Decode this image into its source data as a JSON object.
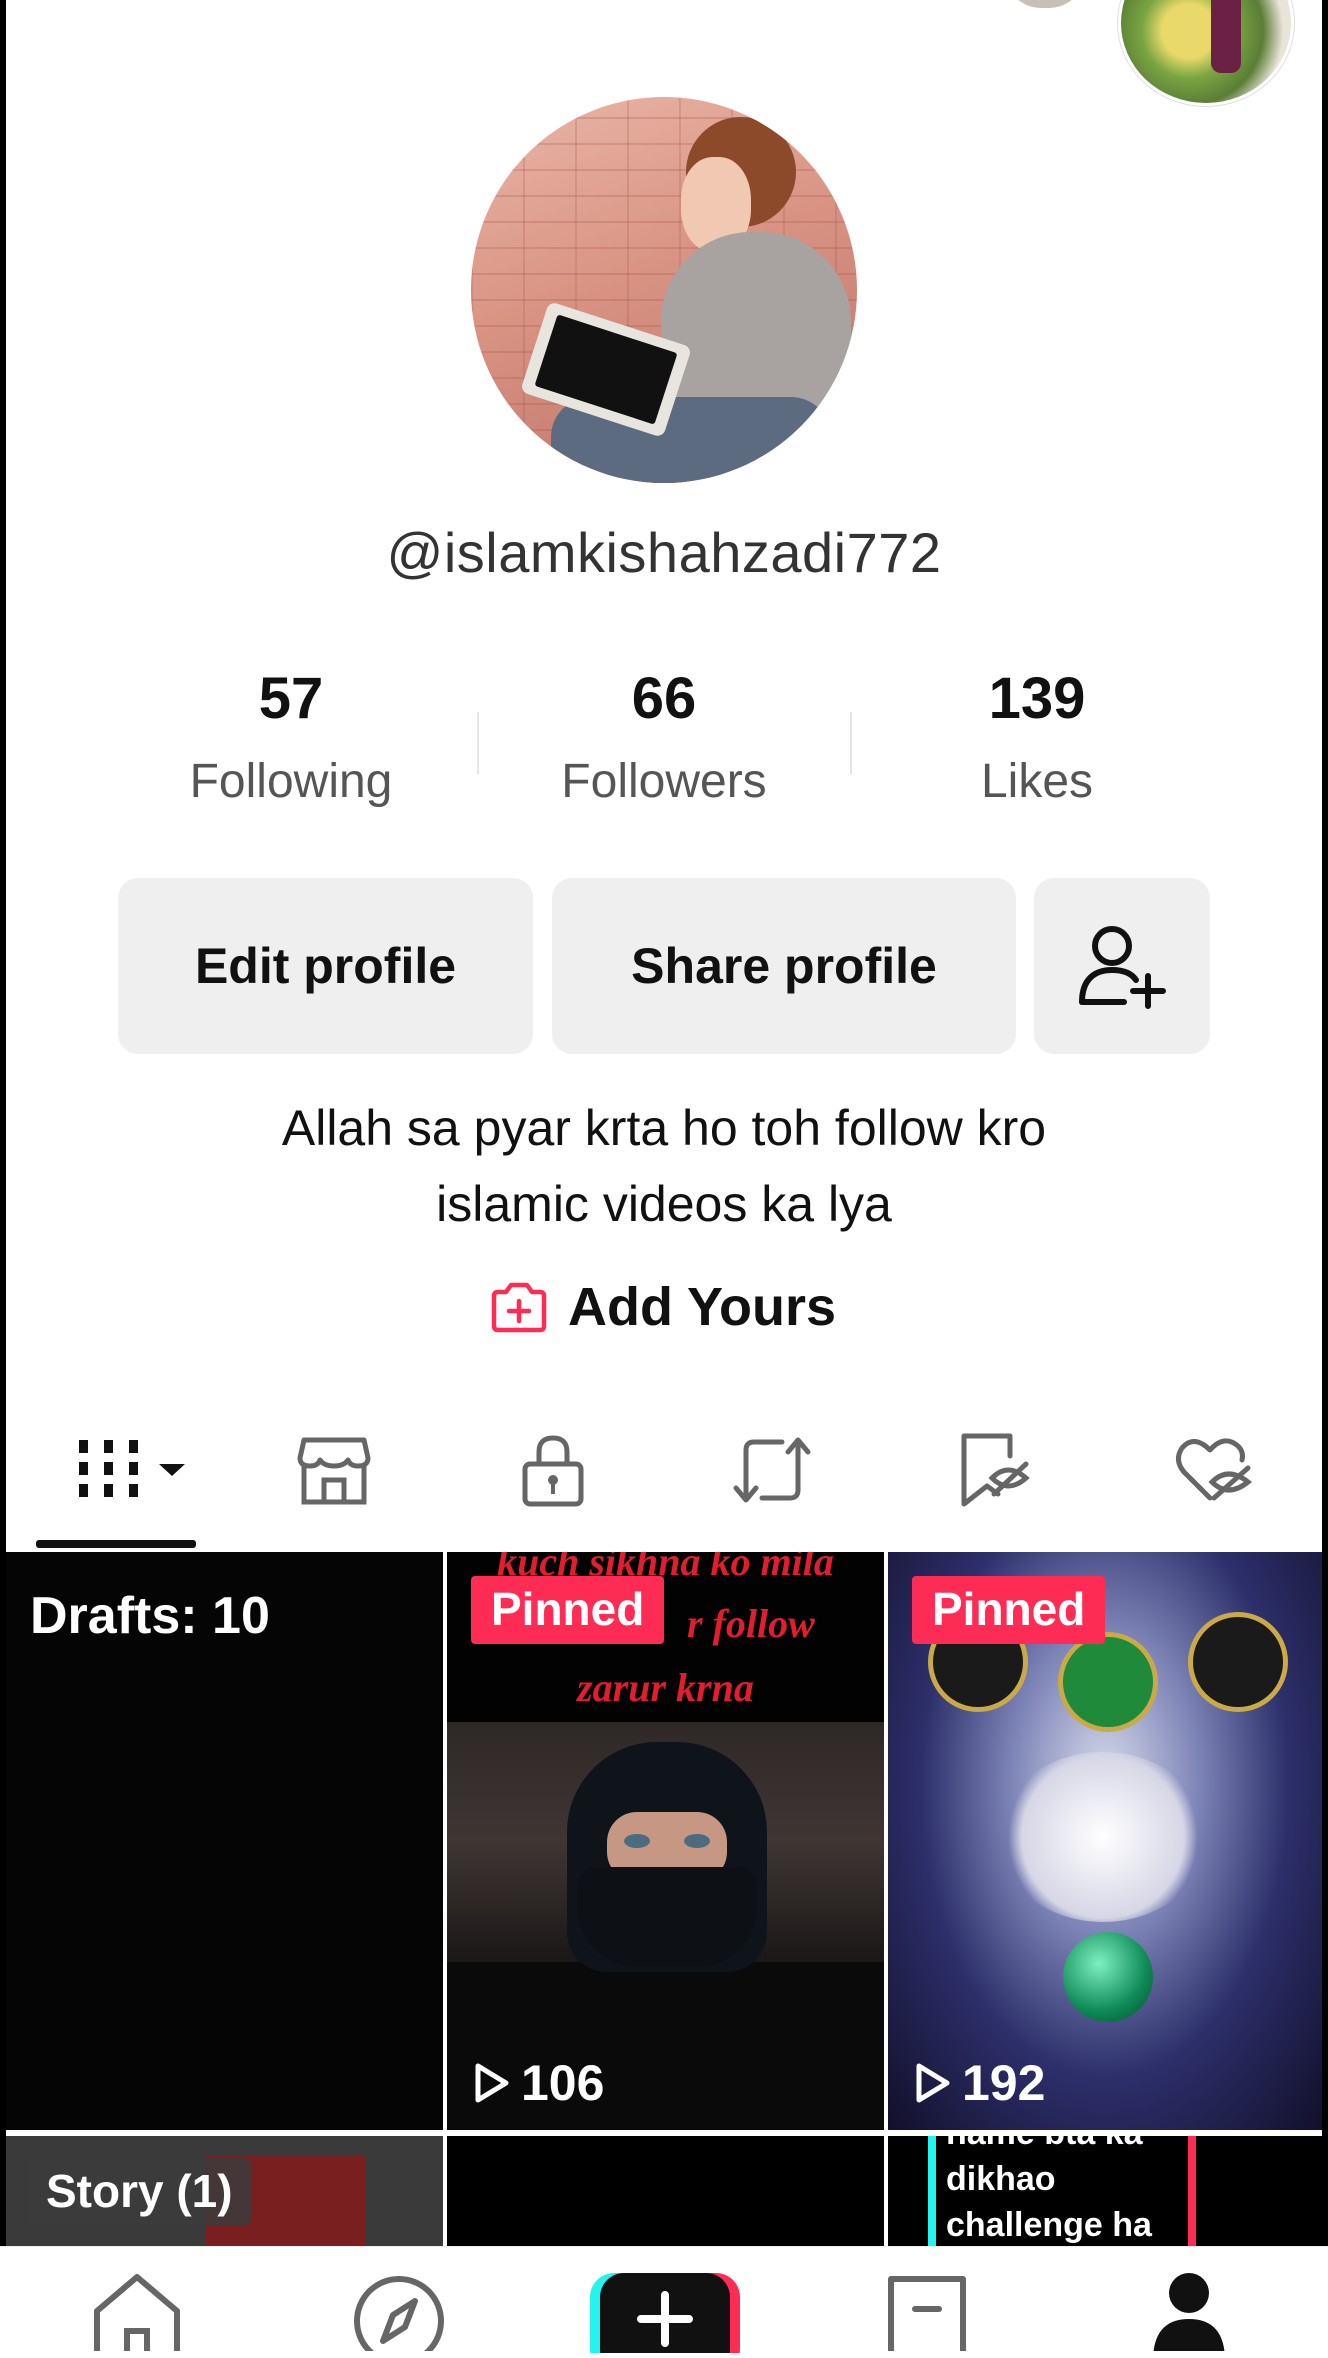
{
  "profile": {
    "username": "@islamkishahzadi772",
    "bio_line1": "Allah sa pyar krta ho toh follow kro",
    "bio_line2": "islamic videos ka lya",
    "add_yours_label": "Add Yours"
  },
  "stats": [
    {
      "value": "57",
      "label": "Following"
    },
    {
      "value": "66",
      "label": "Followers"
    },
    {
      "value": "139",
      "label": "Likes"
    }
  ],
  "buttons": {
    "edit_profile": "Edit profile",
    "share_profile": "Share profile",
    "add_friend_icon": "add-person-icon"
  },
  "tabs": [
    {
      "icon": "grid-icon",
      "selected": true
    },
    {
      "icon": "shop-icon",
      "selected": false
    },
    {
      "icon": "lock-icon",
      "selected": false
    },
    {
      "icon": "repost-icon",
      "selected": false
    },
    {
      "icon": "bookmark-icon",
      "selected": false
    },
    {
      "icon": "heart-icon",
      "selected": false
    }
  ],
  "grid": {
    "drafts_label": "Drafts: 10",
    "video1": {
      "pinned_label": "Pinned",
      "caption_top": "kuch sikhna ko mila",
      "caption_mid": "r follow",
      "caption_bot": "zarur krna",
      "views": "106"
    },
    "video2": {
      "pinned_label": "Pinned",
      "views": "192"
    },
    "story_label": "Story (1)",
    "video4_caption1": "name bta ka",
    "video4_caption2": "dikhao",
    "video4_caption3": "challenge ha"
  },
  "colors": {
    "accent": "#fe2c55",
    "button_bg": "#efefef",
    "text_secondary": "#555555"
  },
  "bottom_nav": [
    {
      "icon": "home-icon"
    },
    {
      "icon": "discover-icon"
    },
    {
      "icon": "create-plus-icon"
    },
    {
      "icon": "inbox-icon"
    },
    {
      "icon": "profile-icon"
    }
  ]
}
